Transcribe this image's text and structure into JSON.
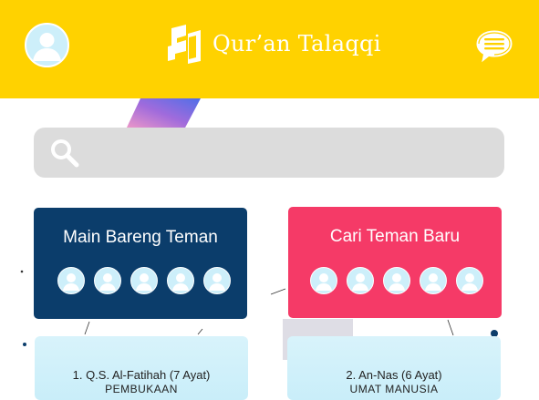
{
  "header": {
    "title": "Qur’an Talaqqi",
    "logo_icon": "quran-talaqqi-logo",
    "avatar_icon": "user-avatar-icon",
    "chat_icon": "chat-bubble-icon",
    "background_color": "#ffd200"
  },
  "search": {
    "placeholder": "",
    "icon": "search-icon"
  },
  "cards": [
    {
      "title": "Main Bareng Teman",
      "color": "#0b3d6b",
      "avatar_count": 5
    },
    {
      "title": "Cari Teman Baru",
      "color": "#f53a67",
      "avatar_count": 5
    }
  ],
  "surahs": [
    {
      "title": "1. Q.S. Al-Fatihah (7 Ayat)",
      "subtitle": "PEMBUKAAN"
    },
    {
      "title": "2. An-Nas (6 Ayat)",
      "subtitle": "UMAT MANUSIA"
    }
  ]
}
